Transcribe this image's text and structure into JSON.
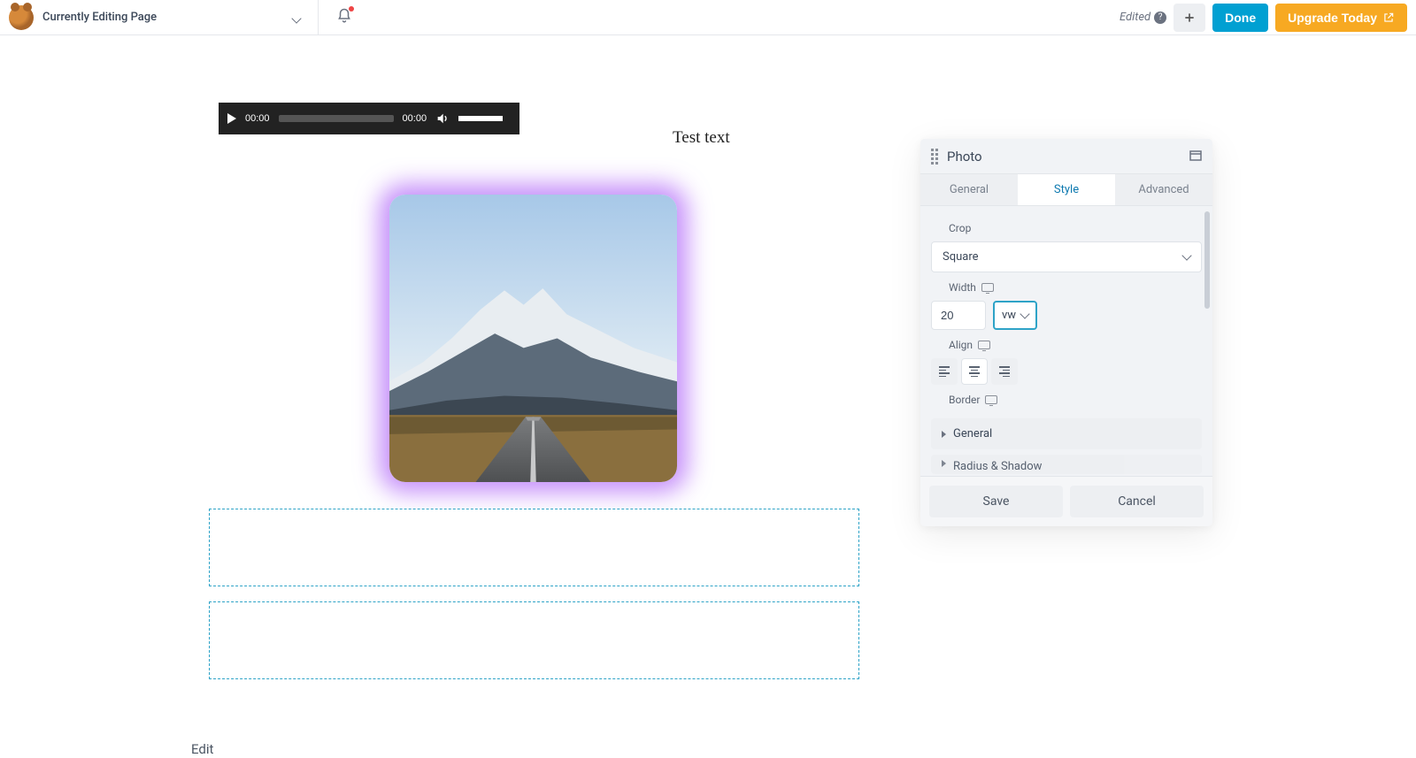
{
  "topbar": {
    "page_title": "Currently Editing Page",
    "edited_label": "Edited",
    "add_label": "+",
    "done_label": "Done",
    "upgrade_label": "Upgrade Today"
  },
  "canvas": {
    "audio": {
      "time_current": "00:00",
      "time_total": "00:00"
    },
    "test_text": "Test text",
    "edit_link": "Edit"
  },
  "panel": {
    "title": "Photo",
    "tabs": {
      "general": "General",
      "style": "Style",
      "advanced": "Advanced"
    },
    "crop": {
      "label": "Crop",
      "value": "Square"
    },
    "width": {
      "label": "Width",
      "value": "20",
      "unit": "vw"
    },
    "align": {
      "label": "Align"
    },
    "border": {
      "label": "Border"
    },
    "accordion": {
      "general": "General",
      "radius_shadow": "Radius & Shadow"
    },
    "footer": {
      "save": "Save",
      "cancel": "Cancel"
    }
  }
}
